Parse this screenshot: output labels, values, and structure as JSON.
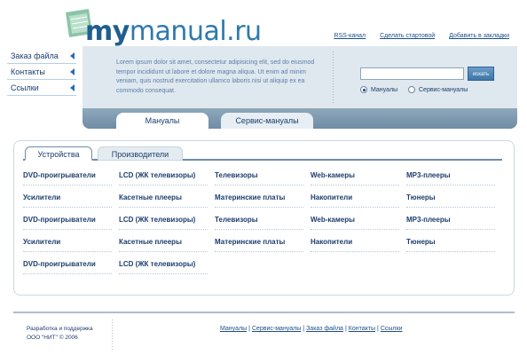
{
  "logo": {
    "my": "my",
    "rest": "manual.ru"
  },
  "top_links": [
    "RSS-канал",
    "Сделать стартовой",
    "Добавить в закладки"
  ],
  "left_nav": [
    "Заказ файла",
    "Контакты",
    "Ссылки"
  ],
  "intro_text": "Lorem ipsum dolor sit amet, consectetur adipisicing elit, sed do eiusmod tempor incididunt ut labore et dolore magna aliqua. Ut enim ad minim veniam, quis nostrud exercitation ullamco laboris nisi ut aliquip ex ea commodo consequat.",
  "search": {
    "value": "",
    "button": "искать",
    "radio_manuals": "Мануалы",
    "radio_service": "Сервис-мануалы",
    "selected": "manuals"
  },
  "header_tabs": [
    "Мануалы",
    "Сервис-мануалы"
  ],
  "content_tabs": [
    "Устройства",
    "Производители"
  ],
  "devices": [
    [
      "DVD-проигрыватели",
      "LCD (ЖК телевизоры)",
      "Телевизоры",
      "Web-камеры",
      "MP3-плееры"
    ],
    [
      "Усилители",
      "Касетные плееры",
      "Материнские платы",
      "Накопители",
      "Тюнеры"
    ],
    [
      "DVD-проигрыватели",
      "LCD (ЖК телевизоры)",
      "Телевизоры",
      "Web-камеры",
      "MP3-плееры"
    ],
    [
      "Усилители",
      "Касетные плееры",
      "Материнские платы",
      "Накопители",
      "Тюнеры"
    ],
    [
      "DVD-проигрыватели",
      "LCD (ЖК телевизоры)"
    ]
  ],
  "footer": {
    "credit_line1": "Разработка и поддержка",
    "credit_line2": "ООО \"НИТ\" © 2006",
    "links": [
      "Мануалы",
      "Сервис-мануалы",
      "Заказ файла",
      "Контакты",
      "Ссылки"
    ]
  },
  "colors": {
    "accent": "#1c3d6e",
    "panel": "#dfe8ef",
    "bar": "#7d98ae"
  },
  "icons": [
    "logo-book-icon",
    "arrow-left-icon",
    "radio-icon"
  ]
}
